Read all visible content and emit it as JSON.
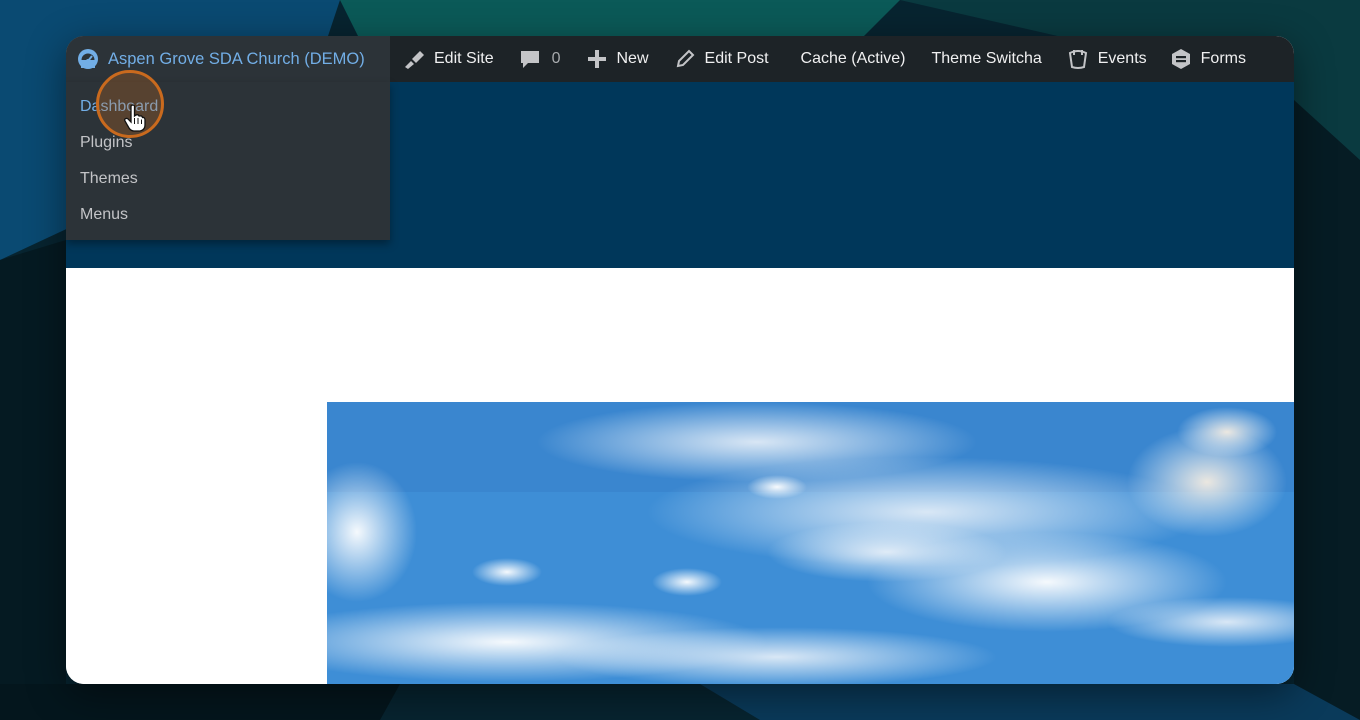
{
  "adminbar": {
    "site_name": "Aspen Grove SDA Church (DEMO)",
    "edit_site": "Edit Site",
    "comments_count": "0",
    "new": "New",
    "edit_post": "Edit Post",
    "cache": "Cache (Active)",
    "theme_switcha": "Theme Switcha",
    "events": "Events",
    "forms": "Forms"
  },
  "submenu": {
    "items": [
      {
        "label": "Dashboard"
      },
      {
        "label": "Plugins"
      },
      {
        "label": "Themes"
      },
      {
        "label": "Menus"
      }
    ]
  },
  "icons": {
    "site": "dashboard-gauge-icon",
    "edit_site": "brush-icon",
    "comments": "comment-bubble-icon",
    "new": "plus-icon",
    "edit_post": "pencil-icon",
    "events": "calendar-icon",
    "forms": "forms-icon",
    "cursor": "hand-pointer-icon"
  },
  "colors": {
    "adminbar_bg": "#1d2327",
    "submenu_bg": "#2c3338",
    "link_blue": "#72aee6",
    "header_blue": "#00375a",
    "highlight_orange": "#c96a1e"
  }
}
